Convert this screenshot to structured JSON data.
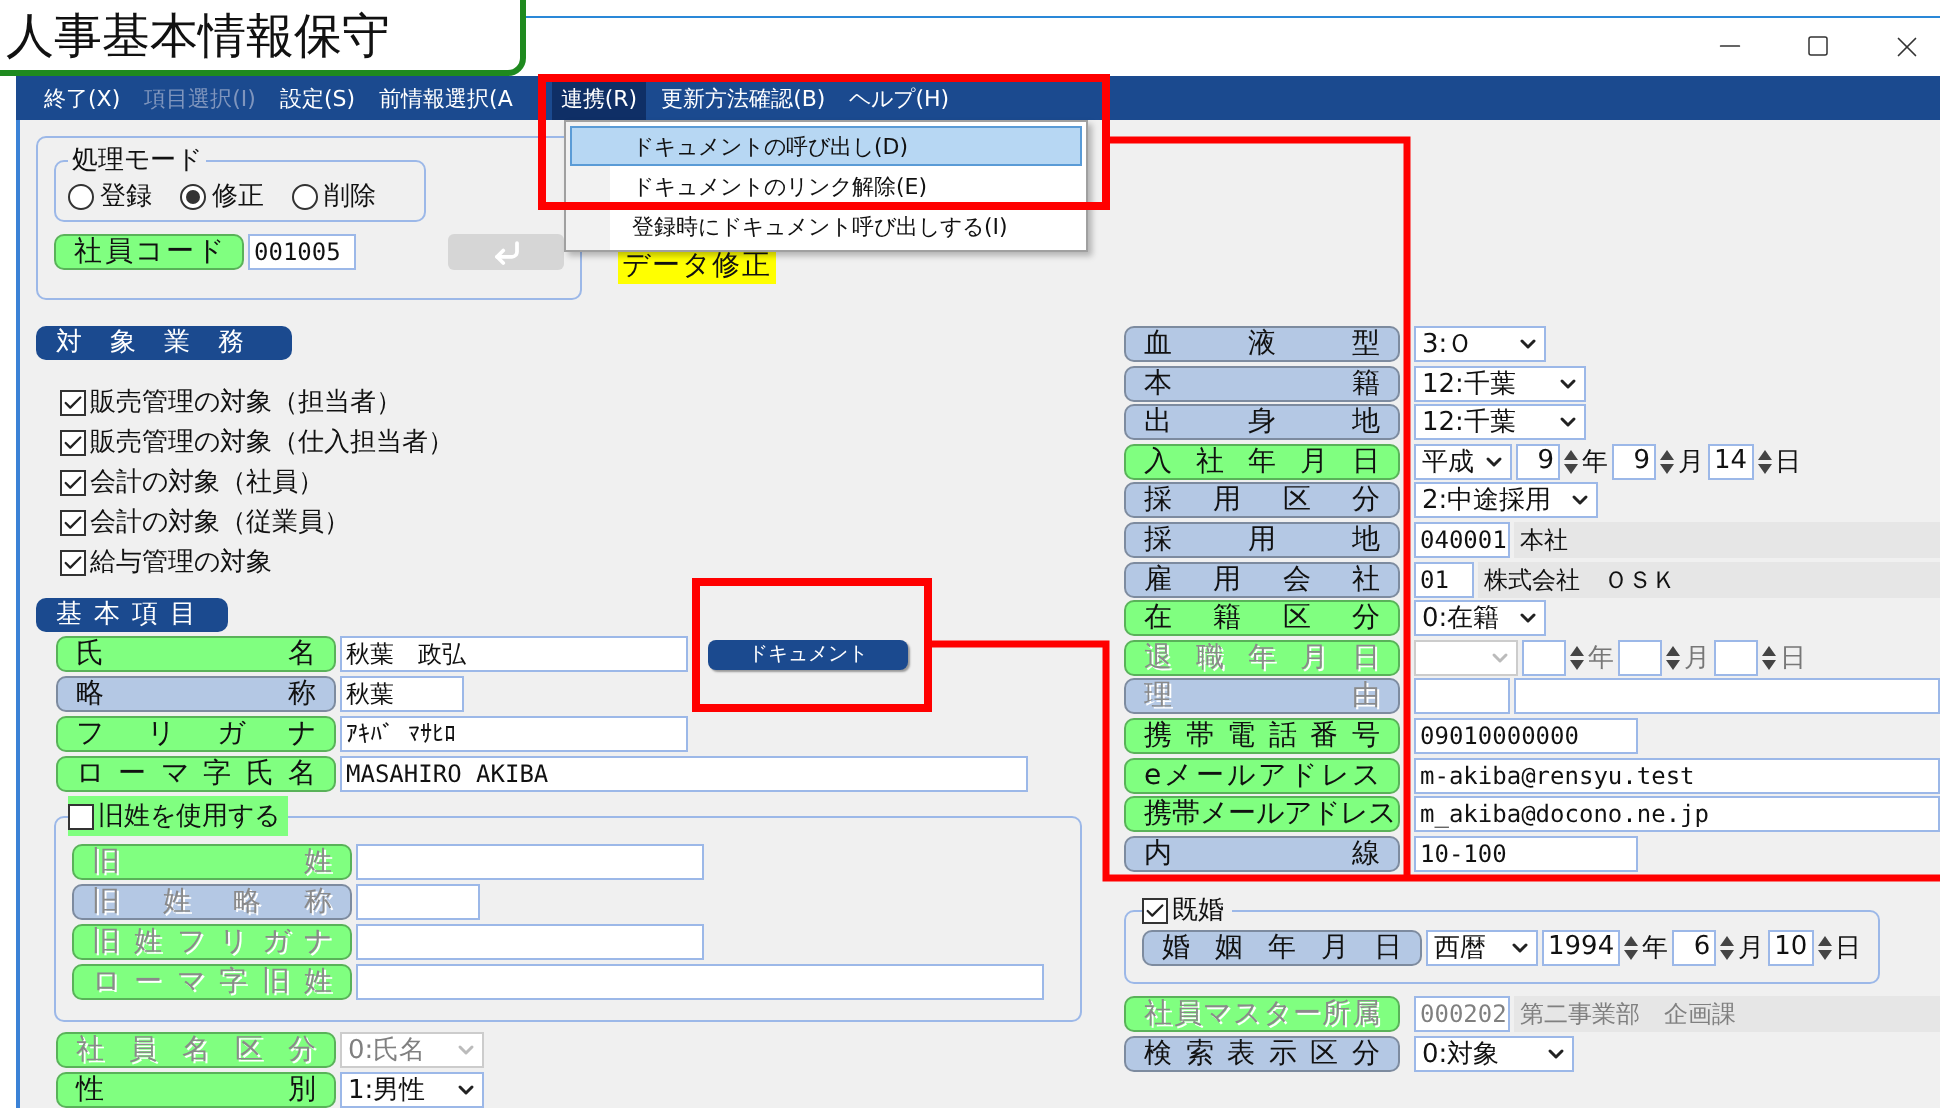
{
  "window": {
    "title": "人事基本情報保守"
  },
  "menu": [
    {
      "label": "終了(X)",
      "disabled": false,
      "selected": false
    },
    {
      "label": "項目選択(I)",
      "disabled": true,
      "selected": false
    },
    {
      "label": "設定(S)",
      "disabled": false,
      "selected": false
    },
    {
      "label": "前情報選択(A",
      "disabled": false,
      "selected": false
    },
    {
      "label": "連携(R)",
      "disabled": false,
      "selected": true
    },
    {
      "label": "更新方法確認(B)",
      "disabled": false,
      "selected": false
    },
    {
      "label": "ヘルプ(H)",
      "disabled": false,
      "selected": false
    }
  ],
  "dropdown": [
    {
      "label": "ドキュメントの呼び出し(D)",
      "selected": true
    },
    {
      "label": "ドキュメントのリンク解除(E)",
      "selected": false
    },
    {
      "label": "登録時にドキュメント呼び出しする(I)",
      "selected": false
    }
  ],
  "processing_mode": {
    "legend": "処理モード",
    "options": [
      {
        "label": "登録",
        "selected": false
      },
      {
        "label": "修正",
        "selected": true
      },
      {
        "label": "削除",
        "selected": false
      }
    ]
  },
  "employee_code": {
    "label": "社員コード",
    "value": "001005"
  },
  "mode_badge": "データ修正",
  "target_business": {
    "title": "対象業務",
    "items": [
      {
        "label": "販売管理の対象（担当者）",
        "checked": true
      },
      {
        "label": "販売管理の対象（仕入担当者）",
        "checked": true
      },
      {
        "label": "会計の対象（社員）",
        "checked": true
      },
      {
        "label": "会計の対象（従業員）",
        "checked": true
      },
      {
        "label": "給与管理の対象",
        "checked": true
      }
    ]
  },
  "basic_items": {
    "title": "基本項目",
    "rows": [
      {
        "label": "氏名",
        "color": "#80ff80",
        "disabled": false,
        "fields": [
          {
            "kind": "text",
            "value": "秋葉　政弘"
          },
          {
            "kind": "button",
            "value": "ドキュメント"
          }
        ]
      },
      {
        "label": "略称",
        "color": "#b4c8e4",
        "disabled": false,
        "fields": [
          {
            "kind": "text",
            "value": "秋葉"
          }
        ]
      },
      {
        "label": "フリガナ",
        "color": "#80ff80",
        "disabled": false,
        "fields": [
          {
            "kind": "text",
            "value": "ｱｷﾊﾞ ﾏｻﾋﾛ"
          }
        ]
      },
      {
        "label": "ローマ字氏名",
        "color": "#80ff80",
        "disabled": false,
        "fields": [
          {
            "kind": "text",
            "value": "MASAHIRO AKIBA"
          }
        ]
      }
    ]
  },
  "old_name": {
    "label": "旧姓を使用する",
    "checked": false,
    "rows": [
      {
        "label": "旧姓",
        "color": "#80ff80",
        "disabled": true,
        "fields": [
          {
            "kind": "text"
          }
        ]
      },
      {
        "label": "旧姓略称",
        "color": "#b4c8e4",
        "disabled": true,
        "fields": [
          {
            "kind": "text"
          }
        ]
      },
      {
        "label": "旧姓フリガナ",
        "color": "#80ff80",
        "disabled": true,
        "fields": [
          {
            "kind": "text"
          }
        ]
      },
      {
        "label": "ローマ字旧姓",
        "color": "#80ff80",
        "disabled": true,
        "fields": [
          {
            "kind": "text"
          }
        ]
      }
    ]
  },
  "bottom_rows": [
    {
      "label": "社員名区分",
      "color": "#80ff80",
      "disabled": true,
      "fields": [
        {
          "kind": "select",
          "value": "0:氏名"
        }
      ]
    },
    {
      "label": "性別",
      "color": "#80ff80",
      "disabled": false,
      "fields": [
        {
          "kind": "select",
          "value": "1:男性"
        }
      ]
    }
  ],
  "personal_rows": [
    {
      "label": "血液型",
      "color": "#b4c8e4",
      "disabled": false,
      "fields": [
        {
          "kind": "select",
          "value": "3:Ｏ"
        }
      ]
    },
    {
      "label": "本籍",
      "color": "#b4c8e4",
      "disabled": false,
      "fields": [
        {
          "kind": "select",
          "value": "12:千葉"
        }
      ]
    },
    {
      "label": "出身地",
      "color": "#b4c8e4",
      "disabled": false,
      "fields": [
        {
          "kind": "select",
          "value": "12:千葉"
        }
      ]
    },
    {
      "label": "入社年月日",
      "color": "#80ff80",
      "disabled": false,
      "fields": [
        {
          "kind": "select",
          "value": "平成"
        },
        {
          "kind": "spin",
          "value": "9"
        },
        {
          "kind": "unit",
          "value": "年"
        },
        {
          "kind": "spin",
          "value": "9"
        },
        {
          "kind": "unit",
          "value": "月"
        },
        {
          "kind": "spin",
          "value": "14"
        },
        {
          "kind": "unit",
          "value": "日"
        }
      ]
    },
    {
      "label": "採用区分",
      "color": "#b4c8e4",
      "disabled": false,
      "fields": [
        {
          "kind": "select",
          "value": "2:中途採用"
        }
      ]
    },
    {
      "label": "採用地",
      "color": "#b4c8e4",
      "disabled": false,
      "fields": [
        {
          "kind": "text",
          "value": "040001"
        },
        {
          "kind": "readonly",
          "value": "本社"
        }
      ]
    },
    {
      "label": "雇用会社",
      "color": "#b4c8e4",
      "disabled": false,
      "fields": [
        {
          "kind": "text",
          "value": "01"
        },
        {
          "kind": "readonly",
          "value": "株式会社　ＯＳＫ"
        }
      ]
    },
    {
      "label": "在籍区分",
      "color": "#80ff80",
      "disabled": false,
      "fields": [
        {
          "kind": "select",
          "value": "0:在籍"
        }
      ]
    },
    {
      "label": "退職年月日",
      "color": "#80ff80",
      "disabled": true,
      "fields": [
        {
          "kind": "select"
        },
        {
          "kind": "spin"
        },
        {
          "kind": "unit",
          "value": "年"
        },
        {
          "kind": "spin"
        },
        {
          "kind": "unit",
          "value": "月"
        },
        {
          "kind": "spin"
        },
        {
          "kind": "unit",
          "value": "日"
        }
      ]
    },
    {
      "label": "理由",
      "color": "#b4c8e4",
      "disabled": true,
      "fields": [
        {
          "kind": "text"
        },
        {
          "kind": "text"
        }
      ]
    },
    {
      "label": "携帯電話番号",
      "color": "#80ff80",
      "disabled": false,
      "fields": [
        {
          "kind": "text",
          "value": "09010000000"
        }
      ]
    },
    {
      "label": "eメールアドレス",
      "color": "#80ff80",
      "disabled": false,
      "fields": [
        {
          "kind": "text",
          "value": "m-akiba@rensyu.test"
        }
      ]
    },
    {
      "label": "携帯メールアドレス",
      "color": "#80ff80",
      "disabled": false,
      "fields": [
        {
          "kind": "text",
          "value": "m_akiba@docono.ne.jp"
        }
      ]
    },
    {
      "label": "内線",
      "color": "#b4c8e4",
      "disabled": false,
      "fields": [
        {
          "kind": "text",
          "value": "10-100"
        }
      ]
    }
  ],
  "married": {
    "label": "既婚",
    "checked": true,
    "rows": [
      {
        "label": "婚姻年月日",
        "color": "#b4c8e4",
        "disabled": false,
        "fields": [
          {
            "kind": "select",
            "value": "西暦"
          },
          {
            "kind": "spin",
            "value": "1994"
          },
          {
            "kind": "unit",
            "value": "年"
          },
          {
            "kind": "spin",
            "value": "6"
          },
          {
            "kind": "unit",
            "value": "月"
          },
          {
            "kind": "spin",
            "value": "10"
          },
          {
            "kind": "unit",
            "value": "日"
          }
        ]
      }
    ]
  },
  "affiliation_rows": [
    {
      "label": "社員マスター所属",
      "color": "#80ff80",
      "disabled": true,
      "fields": [
        {
          "kind": "text",
          "value": "000202"
        },
        {
          "kind": "readonly",
          "value": "第二事業部　企画課"
        }
      ]
    },
    {
      "label": "検索表示区分",
      "color": "#b4c8e4",
      "disabled": false,
      "fields": [
        {
          "kind": "select",
          "value": "0:対象"
        }
      ]
    }
  ]
}
